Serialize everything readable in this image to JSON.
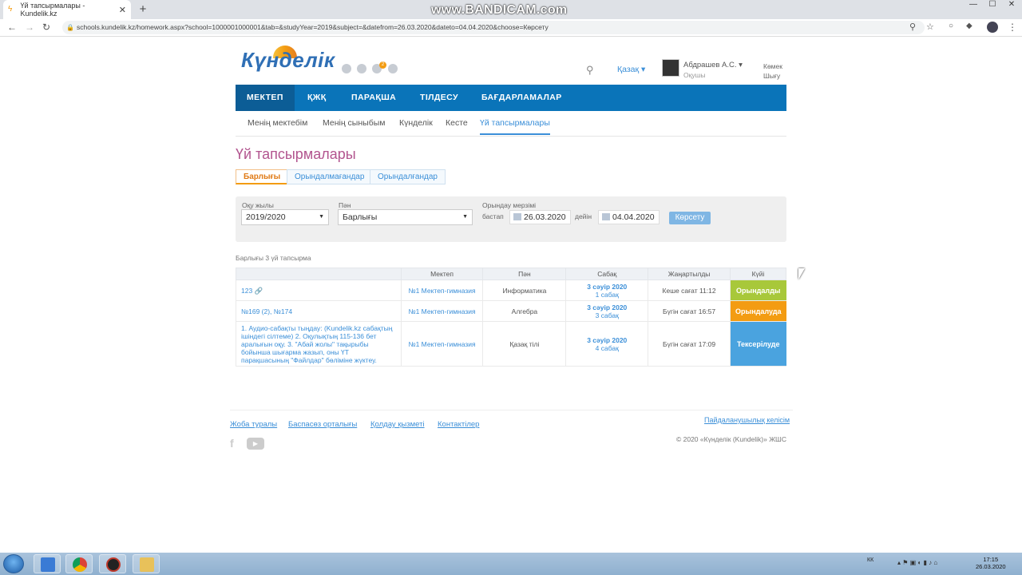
{
  "browser": {
    "tab_title": "Үй тапсырмалары - Kundelik.kz",
    "tab_close": "✕",
    "new_tab": "+",
    "url": "schools.kundelik.kz/homework.aspx?school=1000001000001&tab=&studyYear=2019&subject=&datefrom=26.03.2020&dateto=04.04.2020&choose=Көрсету",
    "watermark": "www.BANDICAM.com",
    "win_min": "—",
    "win_max": "☐",
    "win_close": "✕"
  },
  "header": {
    "logo": "Күнделік",
    "language": "Қазақ ▾",
    "user_name": "Абдрашев А.С. ▾",
    "user_role": "Оқушы",
    "help": "Көмек",
    "exit": "Шығу",
    "notification_count": "2"
  },
  "main_nav": [
    "МЕКТЕП",
    "ҚЖҚ",
    "ПАРАҚША",
    "ТІЛДЕСУ",
    "БАҒДАРЛАМАЛАР"
  ],
  "sub_nav": [
    "Менің мектебім",
    "Менің сыныбым",
    "Күнделік",
    "Кесте",
    "Үй тапсырмалары"
  ],
  "page_title": "Үй тапсырмалары",
  "filter_tabs": [
    "Барлығы",
    "Орындалмағандар",
    "Орындалғандар"
  ],
  "filters": {
    "year_label": "Оқу жылы",
    "year_value": "2019/2020",
    "subject_label": "Пән",
    "subject_value": "Барлығы",
    "deadline_label": "Орындау мерзімі",
    "from_label": "бастап",
    "from_value": "26.03.2020",
    "to_label": "дейін",
    "to_value": "04.04.2020",
    "show_button": "Көрсету"
  },
  "total_text": "Барлығы 3 үй тапсырма",
  "table": {
    "headers": [
      "",
      "Мектеп",
      "Пән",
      "Сабақ",
      "Жаңартылды",
      "Күйі"
    ],
    "rows": [
      {
        "desc": "123 🔗",
        "school": "№1 Мектеп-гимназия",
        "subject": "Информатика",
        "lesson_date": "3 сәуір 2020",
        "lesson_num": "1 сабақ",
        "updated": "Кеше сағат 11:12",
        "status": "Орындалды",
        "status_color": "#a8c83a"
      },
      {
        "desc": "№169 (2), №174",
        "school": "№1 Мектеп-гимназия",
        "subject": "Алгебра",
        "lesson_date": "3 сәуір 2020",
        "lesson_num": "3 сабақ",
        "updated": "Бүгін сағат 16:57",
        "status": "Орындалуда",
        "status_color": "#f39c12"
      },
      {
        "desc": "1. Аудио-сабақты тыңдау: (Kundelik.kz сабақтың ішіндегі сілтеме) 2. Оқулықтың 115-136 бет аралығын оқу. 3. \"Абай жолы\" тақырыбы бойынша шығарма жазып, оны ҮТ парақшасының \"Файлдар\" бөлiмiне жүктеу.",
        "school": "№1 Мектеп-гимназия",
        "subject": "Қазақ тілі",
        "lesson_date": "3 сәуір 2020",
        "lesson_num": "4 сабақ",
        "updated": "Бүгін сағат 17:09",
        "status": "Тексерілуде",
        "status_color": "#4aa3df"
      }
    ]
  },
  "footer": {
    "links": [
      "Жоба туралы",
      "Баспасөз орталығы",
      "Қолдау қызметі",
      "Контактілер"
    ],
    "terms": "Пайдаланушылық келісім",
    "copyright": "© 2020 «Күнделік (Kundelik)» ЖШС",
    "fb": "f",
    "yt": "▶"
  },
  "taskbar": {
    "tray_lang": "КК",
    "time": "17:15",
    "date": "26.03.2020"
  }
}
